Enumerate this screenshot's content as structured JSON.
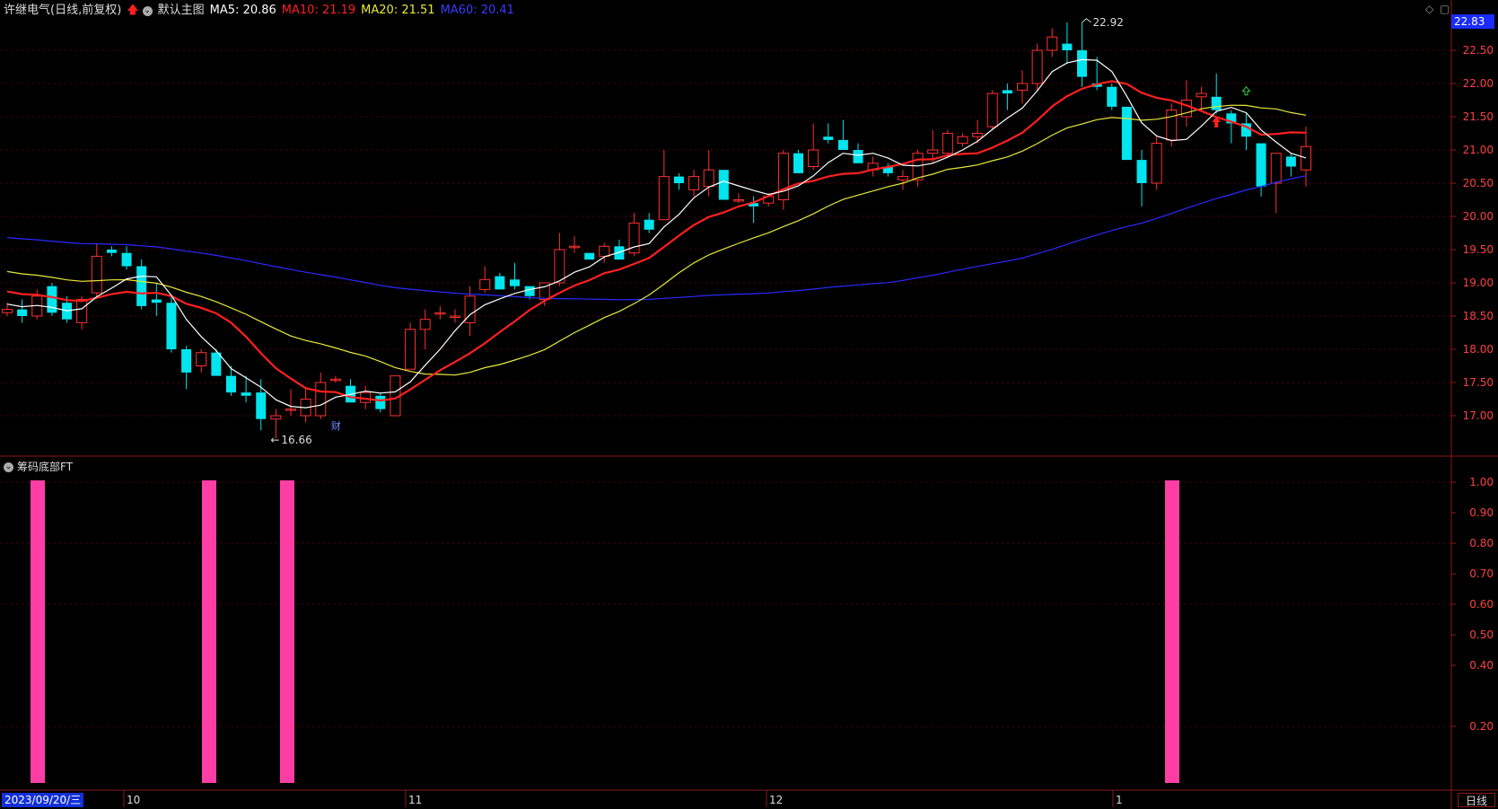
{
  "header": {
    "stock_title": "许继电气(日线,前复权)",
    "main_chart_label": "默认主图",
    "ma_items": [
      {
        "label": "MA5: 20.86",
        "color": "#ffffff"
      },
      {
        "label": "MA10: 21.19",
        "color": "#ff2020"
      },
      {
        "label": "MA20: 21.51",
        "color": "#e8e83a"
      },
      {
        "label": "MA60: 20.41",
        "color": "#2a2aff"
      }
    ],
    "arrow_color": "#ff2020"
  },
  "price_tag": "22.83",
  "price_axis": {
    "ticks": [
      "22.50",
      "22.00",
      "21.50",
      "21.00",
      "20.50",
      "20.00",
      "19.50",
      "19.00",
      "18.50",
      "18.00",
      "17.50",
      "17.00"
    ]
  },
  "annotations": {
    "high_label": "22.92",
    "low_label": "16.66",
    "finance_marker": "财"
  },
  "indicator": {
    "title": "筹码底部FT",
    "ticks": [
      "1.00",
      "0.90",
      "0.80",
      "0.70",
      "0.60",
      "0.50",
      "0.40",
      "0.20"
    ],
    "bar_color": "#ff3ea5",
    "bar_values": [
      1,
      1,
      1,
      1
    ]
  },
  "time_axis": {
    "current_date": "2023/09/20/三",
    "month_labels": [
      "10",
      "11",
      "12",
      "1"
    ],
    "period_button": "日线"
  },
  "colors": {
    "up": "#ff3030",
    "down": "#00e5ee",
    "grid": "#5a0000",
    "axis_text": "#ff4040",
    "ma5": "#ffffff",
    "ma10": "#ff2020",
    "ma20": "#e8e83a",
    "ma60": "#2a2aff"
  }
}
